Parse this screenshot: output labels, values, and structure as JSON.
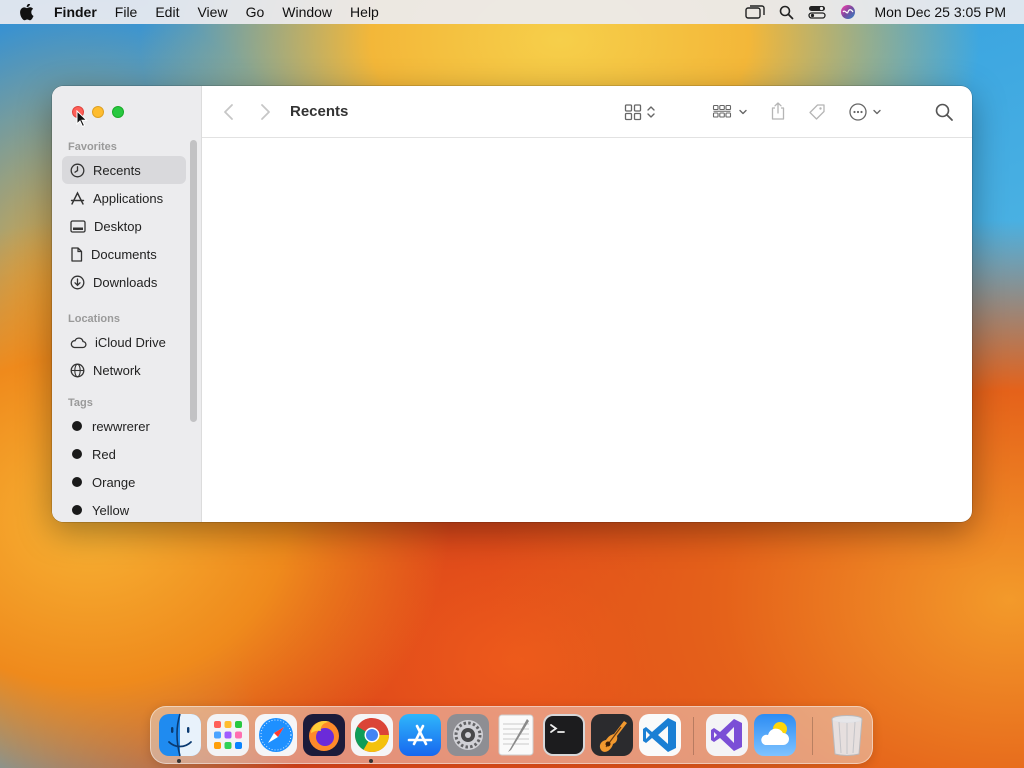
{
  "menubar": {
    "app_name": "Finder",
    "menus": [
      "File",
      "Edit",
      "View",
      "Go",
      "Window",
      "Help"
    ],
    "clock": "Mon Dec 25  3:05 PM"
  },
  "window": {
    "title": "Recents"
  },
  "sidebar": {
    "favorites_title": "Favorites",
    "favorites": [
      {
        "label": "Recents",
        "icon": "clock-icon",
        "selected": true
      },
      {
        "label": "Applications",
        "icon": "applications-icon"
      },
      {
        "label": "Desktop",
        "icon": "desktop-icon"
      },
      {
        "label": "Documents",
        "icon": "document-icon"
      },
      {
        "label": "Downloads",
        "icon": "download-icon"
      }
    ],
    "locations_title": "Locations",
    "locations": [
      {
        "label": "iCloud Drive",
        "icon": "cloud-icon"
      },
      {
        "label": "Network",
        "icon": "globe-icon"
      }
    ],
    "tags_title": "Tags",
    "tags": [
      {
        "label": "rewwrerer"
      },
      {
        "label": "Red"
      },
      {
        "label": "Orange"
      },
      {
        "label": "Yellow"
      }
    ]
  },
  "dock": {
    "apps": [
      "Finder",
      "Launchpad",
      "Safari",
      "Firefox",
      "Chrome",
      "App Store",
      "System Settings",
      "TextEdit",
      "Terminal",
      "GarageBand",
      "Visual Studio Code",
      "Visual Studio",
      "Weather",
      "Trash"
    ]
  }
}
